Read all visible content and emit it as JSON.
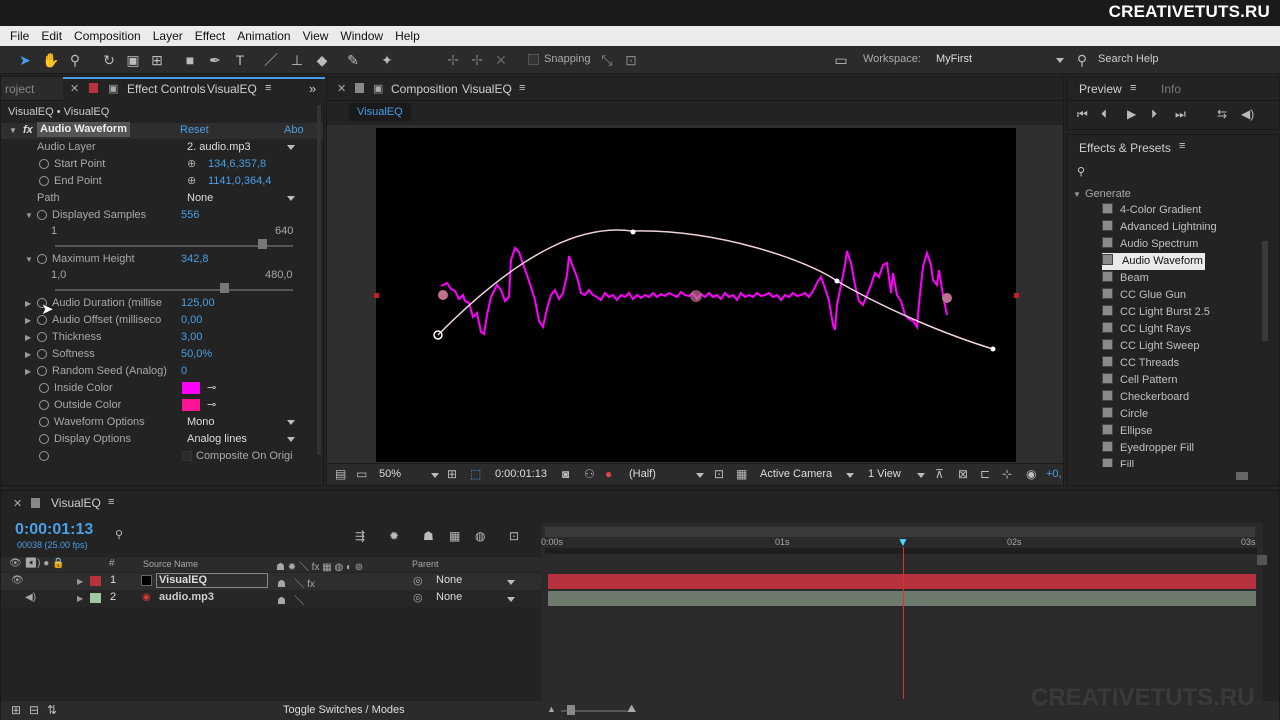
{
  "watermark": {
    "top": "CREATIVETUTS.RU",
    "bottom": "CREATIVETUTS.RU"
  },
  "menu": [
    "File",
    "Edit",
    "Composition",
    "Layer",
    "Effect",
    "Animation",
    "View",
    "Window",
    "Help"
  ],
  "toolbar": {
    "snapping": "Snapping",
    "workspace_label": "Workspace:",
    "workspace_value": "MyFirst",
    "search_help": "Search Help"
  },
  "left_panel": {
    "tab_project": "roject",
    "tab_effect_controls": "Effect Controls",
    "tab_effect_controls_comp": "VisualEQ",
    "breadcrumb": "VisualEQ • VisualEQ",
    "effect_name": "Audio Waveform",
    "reset": "Reset",
    "about": "Abo",
    "props": {
      "audio_layer": {
        "label": "Audio Layer",
        "value": "2. audio.mp3"
      },
      "start_point": {
        "label": "Start Point",
        "value": "134,6,357,8"
      },
      "end_point": {
        "label": "End Point",
        "value": "1141,0,364,4"
      },
      "path": {
        "label": "Path",
        "value": "None"
      },
      "displayed_samples": {
        "label": "Displayed Samples",
        "value": "556",
        "min": "1",
        "max": "640",
        "fraction": 0.87
      },
      "maximum_height": {
        "label": "Maximum Height",
        "value": "342,8",
        "min": "1,0",
        "max": "480,0",
        "fraction": 0.71
      },
      "audio_duration": {
        "label": "Audio Duration (millise",
        "value": "125,00"
      },
      "audio_offset": {
        "label": "Audio Offset (milliseco",
        "value": "0,00"
      },
      "thickness": {
        "label": "Thickness",
        "value": "3,00"
      },
      "softness": {
        "label": "Softness",
        "value": "50,0%"
      },
      "random_seed": {
        "label": "Random Seed (Analog)",
        "value": "0"
      },
      "inside_color": {
        "label": "Inside Color",
        "color": "#ff00ff"
      },
      "outside_color": {
        "label": "Outside Color",
        "color": "#ff1493"
      },
      "waveform_options": {
        "label": "Waveform Options",
        "value": "Mono"
      },
      "display_options": {
        "label": "Display Options",
        "value": "Analog lines"
      },
      "composite": {
        "label": "Composite On Origi"
      }
    }
  },
  "comp_panel": {
    "tab": "Composition",
    "tab_comp": "VisualEQ",
    "subtab": "VisualEQ",
    "zoom": "50%",
    "timecode": "0:00:01:13",
    "resolution": "(Half)",
    "camera": "Active Camera",
    "view": "1 View",
    "offset": "+0,"
  },
  "preview_panel": {
    "tab_preview": "Preview",
    "tab_info": "Info"
  },
  "effects_presets": {
    "title": "Effects & Presets",
    "search_placeholder": "",
    "category": "Generate",
    "items": [
      "4-Color Gradient",
      "Advanced Lightning",
      "Audio Spectrum",
      "Audio Waveform",
      "Beam",
      "CC Glue Gun",
      "CC Light Burst 2.5",
      "CC Light Rays",
      "CC Light Sweep",
      "CC Threads",
      "Cell Pattern",
      "Checkerboard",
      "Circle",
      "Ellipse",
      "Eyedropper Fill",
      "Fill"
    ],
    "selected_index": 3
  },
  "timeline": {
    "tab": "VisualEQ",
    "timecode": "0:00:01:13",
    "frames": "00038 (25.00 fps)",
    "col_source": "Source Name",
    "col_parent": "Parent",
    "hash": "#",
    "ruler": [
      "0:00s",
      "01s",
      "02s",
      "03s"
    ],
    "layers": [
      {
        "num": "1",
        "name": "VisualEQ",
        "parent": "None",
        "color": "#b5323e"
      },
      {
        "num": "2",
        "name": "audio.mp3",
        "parent": "None",
        "color": "#9fc99f"
      }
    ],
    "toggle": "Toggle Switches / Modes"
  }
}
